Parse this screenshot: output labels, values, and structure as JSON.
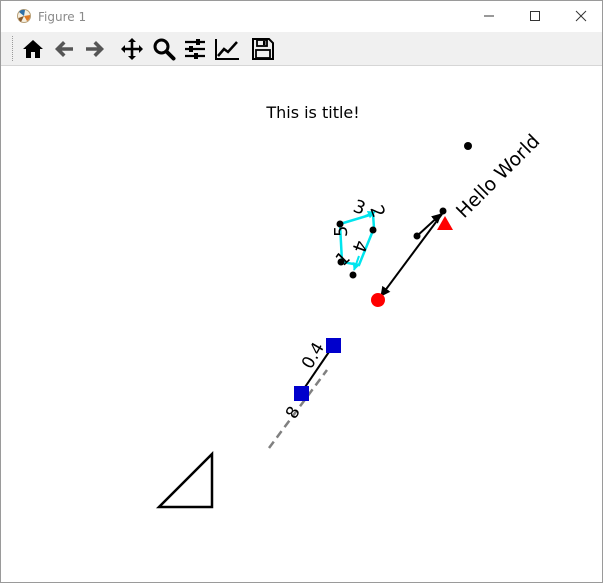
{
  "window": {
    "title": "Figure 1"
  },
  "toolbar": {
    "tools": [
      {
        "icon": "home-icon",
        "label": "Home"
      },
      {
        "icon": "back-arrow-icon",
        "label": "Back"
      },
      {
        "icon": "forward-arrow-icon",
        "label": "Forward"
      },
      {
        "icon": "pan-icon",
        "label": "Pan"
      },
      {
        "icon": "zoom-icon",
        "label": "Zoom"
      },
      {
        "icon": "configure-subplots-icon",
        "label": "Subplots"
      },
      {
        "icon": "edit-axis-icon",
        "label": "Customize"
      },
      {
        "icon": "save-icon",
        "label": "Save"
      }
    ]
  },
  "plot": {
    "title": "This is title!",
    "hello_text": "Hello World",
    "colors": {
      "cyan": "#00e5ee",
      "red": "#ff0000",
      "blue": "#0000cc",
      "dashed": "#808080"
    },
    "polygon_labels": [
      "1",
      "2",
      "3",
      "4",
      "5"
    ],
    "square_labels": [
      "0.4",
      "8"
    ]
  }
}
